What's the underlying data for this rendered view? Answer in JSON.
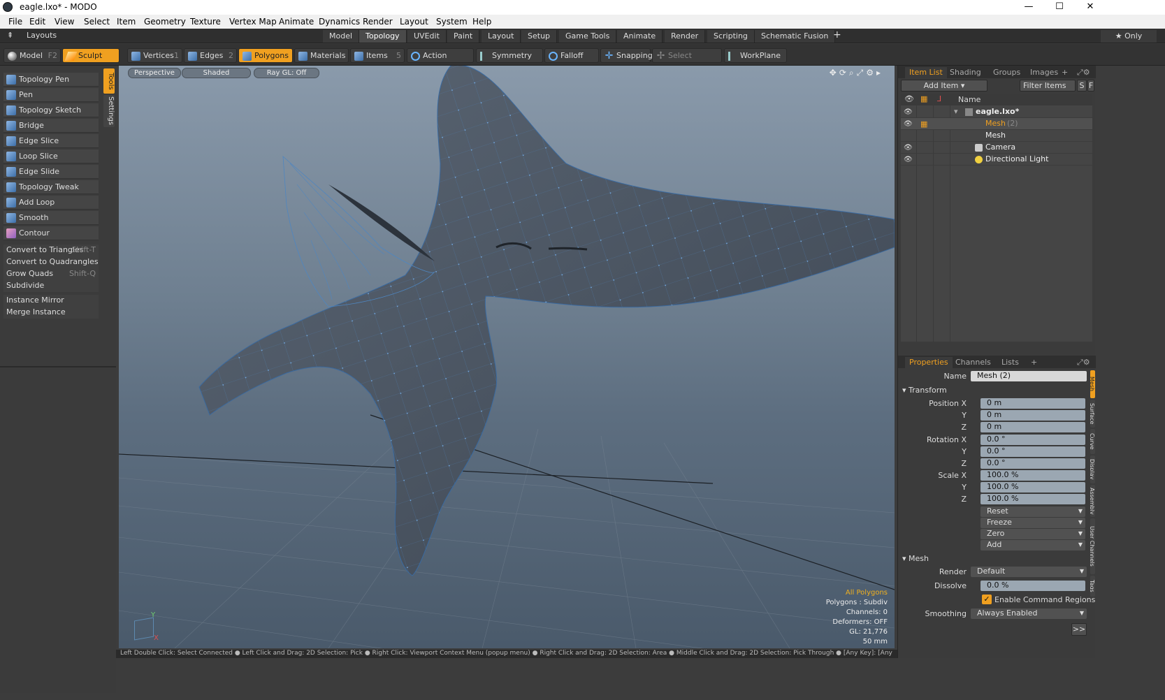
{
  "window": {
    "title": "eagle.lxo* - MODO",
    "min": "—",
    "max": "☐",
    "close": "✕"
  },
  "menu": [
    "File",
    "Edit",
    "View",
    "Select",
    "Item",
    "Geometry",
    "Texture",
    "Vertex Map",
    "Animate",
    "Dynamics",
    "Render",
    "Layout",
    "System",
    "Help"
  ],
  "layoutbar": {
    "label": "Layouts",
    "tabs": [
      "Model",
      "Topology",
      "UVEdit",
      "Paint",
      "Layout",
      "Setup",
      "Game Tools",
      "Animate",
      "Render",
      "Scripting",
      "Schematic Fusion"
    ],
    "active": "Topology",
    "plus": "+",
    "only": "★ Only"
  },
  "modebar": {
    "model": "Model",
    "model_key": "F2",
    "sculpt": "Sculpt",
    "vertices": "Vertices",
    "vertices_n": "1",
    "edges": "Edges",
    "edges_n": "2",
    "polygons": "Polygons",
    "materials": "Materials",
    "items": "Items",
    "items_n": "5",
    "action_center": "Action Center",
    "symmetry": "Symmetry",
    "falloff": "Falloff",
    "snapping": "Snapping",
    "select_through": "Select Through",
    "workplane": "WorkPlane"
  },
  "tools": [
    "Topology Pen",
    "Pen",
    "Topology Sketch",
    "Bridge",
    "Edge Slice",
    "Loop Slice",
    "Edge Slide",
    "Topology Tweak",
    "Add Loop",
    "Smooth",
    "Contour"
  ],
  "commands": [
    {
      "label": "Convert to Triangles",
      "shortcut": "Shift-T"
    },
    {
      "label": "Convert to Quadrangles",
      "shortcut": ""
    },
    {
      "label": "Grow Quads",
      "shortcut": "Shift-Q"
    },
    {
      "label": "Subdivide",
      "shortcut": ""
    }
  ],
  "commands2": [
    "Instance Mirror",
    "Merge Instance"
  ],
  "toolvtabs": [
    "Tools",
    "Settings"
  ],
  "viewport": {
    "perspective": "Perspective",
    "shaded": "Shaded",
    "raygl": "Ray GL: Off",
    "info": [
      "All Polygons",
      "Polygons : Subdiv",
      "Channels: 0",
      "Deformers: OFF",
      "GL: 21,776",
      "50 mm"
    ],
    "axis_x": "X",
    "axis_y": "Y"
  },
  "status": "Left Double Click: Select Connected ● Left Click and Drag: 2D Selection: Pick ● Right Click: Viewport Context Menu (popup menu) ● Right Click and Drag: 2D Selection: Area ● Middle Click and Drag: 2D Selection: Pick Through ● [Any Key]: [Any",
  "itemlist": {
    "tabs": [
      "Item List",
      "Shading",
      "Groups",
      "Images"
    ],
    "add_item": "Add Item",
    "filter": "Filter Items",
    "s": "S",
    "f": "F",
    "col_name": "Name",
    "rows": [
      {
        "name": "eagle.lxo*",
        "extra": ""
      },
      {
        "name": "Mesh",
        "extra": "(2)"
      },
      {
        "name": "Mesh",
        "extra": ""
      },
      {
        "name": "Camera",
        "extra": ""
      },
      {
        "name": "Directional Light",
        "extra": ""
      }
    ]
  },
  "properties": {
    "tabs": [
      "Properties",
      "Channels",
      "Lists"
    ],
    "name_label": "Name",
    "name_value": "Mesh (2)",
    "transform": "Transform",
    "pos_label": "Position X",
    "y": "Y",
    "z": "Z",
    "pos": [
      "0 m",
      "0 m",
      "0 m"
    ],
    "rot_label": "Rotation X",
    "rot": [
      "0.0 °",
      "0.0 °",
      "0.0 °"
    ],
    "scale_label": "Scale X",
    "scale": [
      "100.0 %",
      "100.0 %",
      "100.0 %"
    ],
    "actions": [
      "Reset",
      "Freeze",
      "Zero",
      "Add"
    ],
    "mesh": "Mesh",
    "render_label": "Render",
    "render_value": "Default",
    "dissolve_label": "Dissolve",
    "dissolve_value": "0.0 %",
    "enable_cmd": "Enable Command Regions",
    "smoothing_label": "Smoothing",
    "smoothing_value": "Always Enabled",
    "more": ">>"
  },
  "rightvtabs": [
    "Mesh",
    "Surface",
    "Curve",
    "Display",
    "Assembly",
    "User Channels",
    "Tags"
  ]
}
